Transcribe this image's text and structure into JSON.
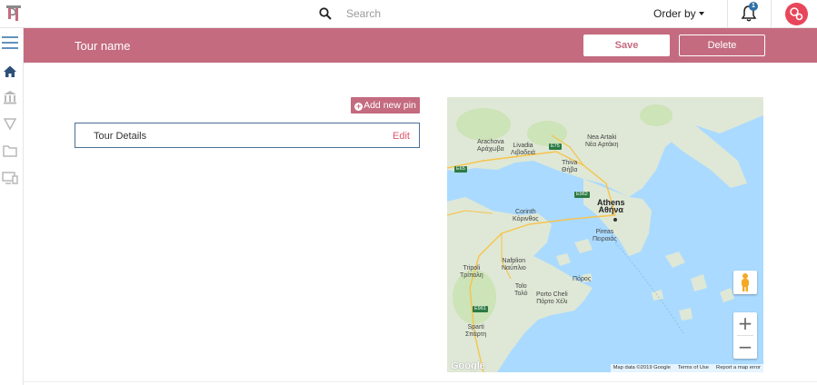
{
  "topbar": {
    "search_placeholder": "Search",
    "order_by_label": "Order by",
    "notification_count": "1"
  },
  "sidebar": {
    "items": [
      {
        "icon": "menu-icon"
      },
      {
        "icon": "home-icon"
      },
      {
        "icon": "museum-icon"
      },
      {
        "icon": "pin-icon"
      },
      {
        "icon": "folder-icon"
      },
      {
        "icon": "devices-icon"
      }
    ]
  },
  "header": {
    "tour_name": "Tour name",
    "save_label": "Save",
    "delete_label": "Delete"
  },
  "content": {
    "add_pin_label": "Add new pin",
    "details_title": "Tour Details",
    "details_edit": "Edit"
  },
  "map": {
    "labels": {
      "arachova": "Arachova\nΑράχωβα",
      "livadia": "Livadia\nΛιβαδειά",
      "nea_artaki": "Nea Artaki\nΝέα Αρτάκη",
      "thiva": "Thiva\nΘήβα",
      "athens": "Athens\nΑθήνα",
      "corinth": "Corinth\nΚόρινθος",
      "pireas": "Pireas\nΠειραιάς",
      "tripoli": "Tripoli\nΤρίπολη",
      "nafplion": "Nafplion\nΝαύπλιο",
      "poros": "Πόρος",
      "tolo": "Tolo\nΤολό",
      "porto_cheli": "Porto Cheli\nΠόρτο Χέλι",
      "sparti": "Sparti\nΣπάρτη"
    },
    "shields": {
      "e75": "E75",
      "e65": "E65",
      "e962": "E962",
      "e961": "E961"
    },
    "google_label": "Google",
    "map_data": "Map data ©2019 Google",
    "terms": "Terms of Use",
    "report": "Report a map error",
    "zoom_in": "+",
    "zoom_out": "−"
  },
  "colors": {
    "accent": "#c46b7f",
    "avatar": "#e8465a",
    "edit_link": "#e0566b",
    "card_border": "#4a6f95",
    "water": "#aadaff",
    "land": "#dfe8d6"
  }
}
